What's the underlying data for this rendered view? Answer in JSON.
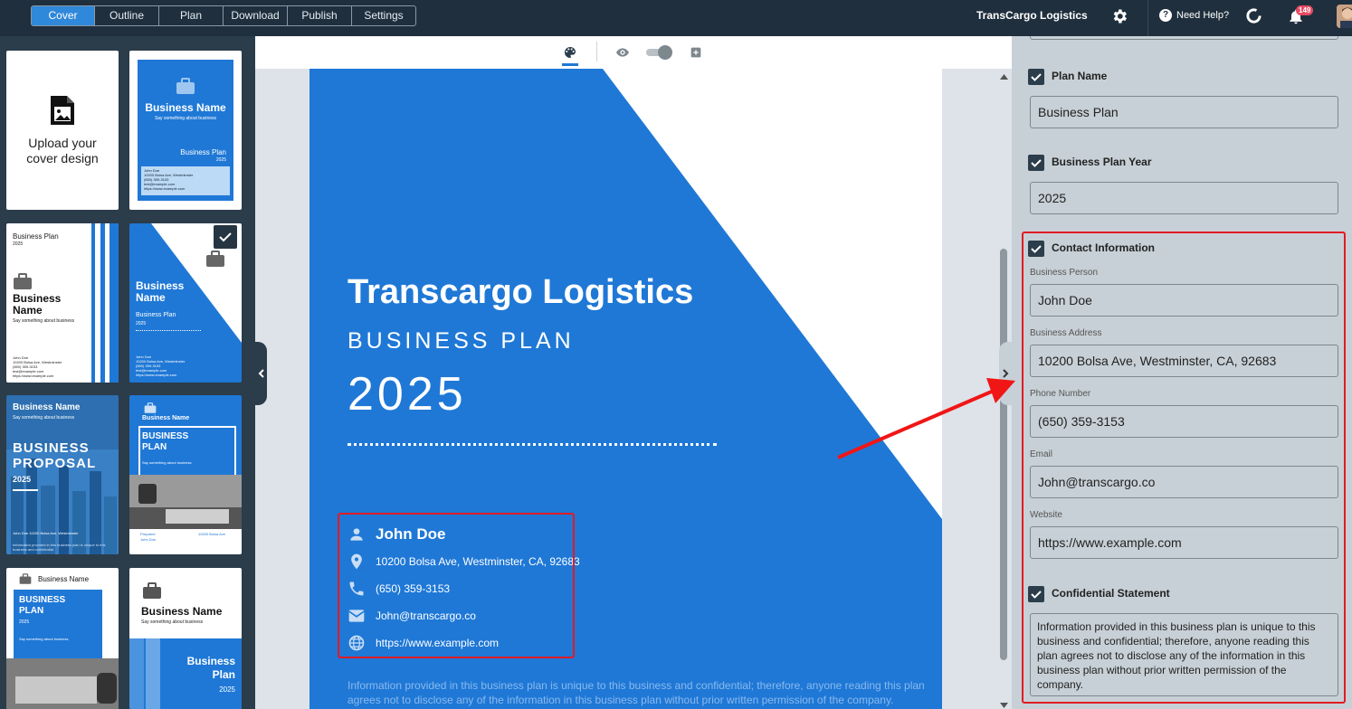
{
  "topbar": {
    "tabs": [
      {
        "label": "Cover",
        "active": true
      },
      {
        "label": "Outline",
        "active": false
      },
      {
        "label": "Plan",
        "active": false
      },
      {
        "label": "Download",
        "active": false
      },
      {
        "label": "Publish",
        "active": false
      },
      {
        "label": "Settings",
        "active": false
      }
    ],
    "brand": "TransCargo Logistics",
    "help_label": "Need Help?",
    "notification_count": "149"
  },
  "left_panel": {
    "upload_label": "Upload your\ncover design",
    "templates": [
      {
        "title": "Business Name",
        "tagline": "Say something about business",
        "plan": "Business Plan",
        "year": "2025",
        "contact_lines": [
          "John Doe",
          "10200 Bolsa Ave, Westminster",
          "(650) 359-3153",
          "test@example.com",
          "https://www.example.com"
        ]
      },
      {
        "top_label": "Business Plan",
        "year": "2025",
        "title": "Business Name",
        "tagline": "Say something about business",
        "contact_lines": [
          "John Doe",
          "10200 Bolsa Ave, Westminster",
          "(650) 359-3153",
          "test@example.com",
          "https://www.example.com"
        ]
      },
      {
        "title": "Business Name",
        "plan": "Business Plan",
        "year": "2025",
        "selected": true,
        "contact_lines": [
          "John Doe",
          "10200 Bolsa Ave, Westminster",
          "(650) 359-3153",
          "test@example.com",
          "https://www.example.com"
        ]
      },
      {
        "title": "Business Name",
        "tagline": "Say something about business",
        "big1": "BUSINESS",
        "big2": "PROPOSAL",
        "year": "2025",
        "contact": "John Doe  10200 Bolsa Ave, Westminster",
        "footer": "Information provided in this business plan is unique to this business and confidential."
      },
      {
        "title": "Business Name",
        "big1": "BUSINESS",
        "big2": "PLAN",
        "tagline": "Say something about business",
        "prepared": "Prepared",
        "person": "John Doe",
        "address": "10200 Bolsa Ave"
      },
      {
        "title": "Business Name",
        "big1": "BUSINESS",
        "big2": "PLAN",
        "year": "2025",
        "tagline": "Say something about business"
      },
      {
        "title": "Business Name",
        "tagline": "Say something about business",
        "plan1": "Business",
        "plan2": "Plan",
        "year": "2025"
      }
    ]
  },
  "cover": {
    "title": "Transcargo Logistics",
    "subtitle": "BUSINESS PLAN",
    "year": "2025",
    "contact": {
      "name": "John Doe",
      "address": "10200 Bolsa Ave, Westminster, CA, 92683",
      "phone": "(650) 359-3153",
      "email": "John@transcargo.co",
      "website": "https://www.example.com"
    },
    "confidential": "Information provided in this business plan is unique to this business and confidential; therefore, anyone reading this plan agrees not to disclose any of the information in this business plan without prior written permission of the company."
  },
  "form": {
    "plan_name_label": "Plan Name",
    "plan_name_value": "Business Plan",
    "year_label": "Business Plan Year",
    "year_value": "2025",
    "contact_label": "Contact Information",
    "person_label": "Business Person",
    "person_value": "John Doe",
    "address_label": "Business Address",
    "address_value": "10200 Bolsa Ave, Westminster, CA, 92683",
    "phone_label": "Phone Number",
    "phone_value": "(650) 359-3153",
    "email_label": "Email",
    "email_value": "John@transcargo.co",
    "website_label": "Website",
    "website_value": "https://www.example.com",
    "confidential_label": "Confidential Statement",
    "confidential_value": "Information provided in this business plan is unique to this business and confidential; therefore, anyone reading this plan agrees not to disclose any of the information in this business plan without prior written permission of the company."
  },
  "colors": {
    "accent": "#1f78d6",
    "topbar": "#1f2f3d",
    "highlight": "#e01b24"
  }
}
